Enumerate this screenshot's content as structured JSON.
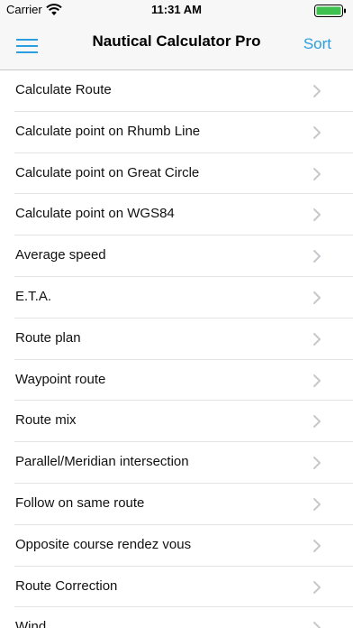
{
  "status_bar": {
    "carrier": "Carrier",
    "time": "11:31 AM"
  },
  "nav": {
    "title": "Nautical Calculator Pro",
    "sort_label": "Sort",
    "accent_color": "#2a9ede"
  },
  "items": [
    "Calculate Route",
    "Calculate point on Rhumb Line",
    "Calculate point on Great Circle",
    "Calculate point on WGS84",
    "Average speed",
    "E.T.A.",
    "Route plan",
    "Waypoint route",
    "Route mix",
    "Parallel/Meridian intersection",
    "Follow on same route",
    "Opposite course rendez vous",
    "Route Correction",
    "Wind"
  ],
  "icons": {
    "menu": "hamburger-menu-icon",
    "row": "chevron-right-icon",
    "wifi": "wifi-icon",
    "battery": "battery-icon"
  }
}
